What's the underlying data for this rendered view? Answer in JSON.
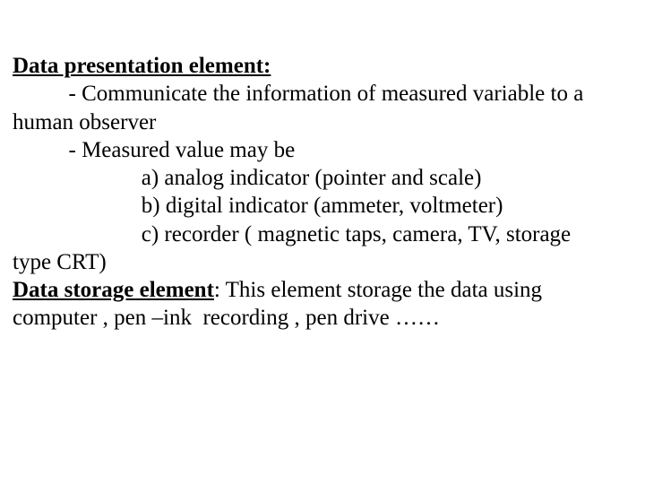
{
  "lines": [
    {
      "segments": [
        {
          "text": "Data presentation element:",
          "bold": true,
          "underline": true
        }
      ]
    },
    {
      "segments": [
        {
          "text": "          - Communicate the information of measured variable to a"
        }
      ]
    },
    {
      "segments": [
        {
          "text": "human observer"
        }
      ]
    },
    {
      "segments": [
        {
          "text": "          - Measured value may be"
        }
      ]
    },
    {
      "segments": [
        {
          "text": "                       a) analog indicator (pointer and scale)"
        }
      ]
    },
    {
      "segments": [
        {
          "text": "                       b) digital indicator (ammeter, voltmeter)"
        }
      ]
    },
    {
      "segments": [
        {
          "text": "                       c) recorder ( magnetic taps, camera, TV, storage"
        }
      ]
    },
    {
      "segments": [
        {
          "text": "type CRT)"
        }
      ]
    },
    {
      "segments": [
        {
          "text": "Data storage element",
          "bold": true,
          "underline": true
        },
        {
          "text": ": This element storage the data using"
        }
      ]
    },
    {
      "segments": [
        {
          "text": "computer , pen –ink  recording , pen drive ……"
        }
      ]
    }
  ]
}
